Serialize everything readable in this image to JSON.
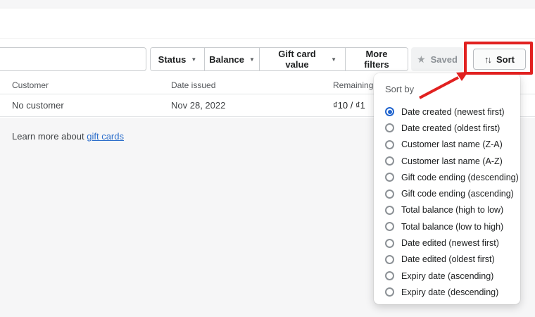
{
  "filters": {
    "search_value": "",
    "search_placeholder": "",
    "segments": [
      {
        "label": "Status",
        "has_caret": true
      },
      {
        "label": "Balance",
        "has_caret": true
      },
      {
        "label": "Gift card value",
        "has_caret": true
      },
      {
        "label": "More filters",
        "has_caret": false
      }
    ],
    "saved_label": "Saved",
    "sort_label": "Sort",
    "caret_glyph": "▼",
    "star_glyph": "★",
    "sort_arrows_glyph": "↑↓"
  },
  "table": {
    "columns": [
      "Customer",
      "Date issued",
      "Remaining"
    ],
    "rows": [
      [
        "No customer",
        "Nov 28, 2022",
        "₫10 / ₫1"
      ]
    ]
  },
  "footer": {
    "learn_more_prefix": "Learn more about ",
    "link_label": "gift cards"
  },
  "sort_popover": {
    "title": "Sort by",
    "selected_index": 0,
    "options": [
      "Date created (newest first)",
      "Date created (oldest first)",
      "Customer last name (Z-A)",
      "Customer last name (A-Z)",
      "Gift code ending (descending)",
      "Gift code ending (ascending)",
      "Total balance (high to low)",
      "Total balance (low to high)",
      "Date edited (newest first)",
      "Date edited (oldest first)",
      "Expiry date (ascending)",
      "Expiry date (descending)"
    ]
  },
  "annotations": {
    "highlight_color": "#e12120"
  },
  "colors": {
    "accent_blue": "#2265ce",
    "link_blue": "#2c6ecb",
    "page_gray": "#f6f6f7"
  }
}
